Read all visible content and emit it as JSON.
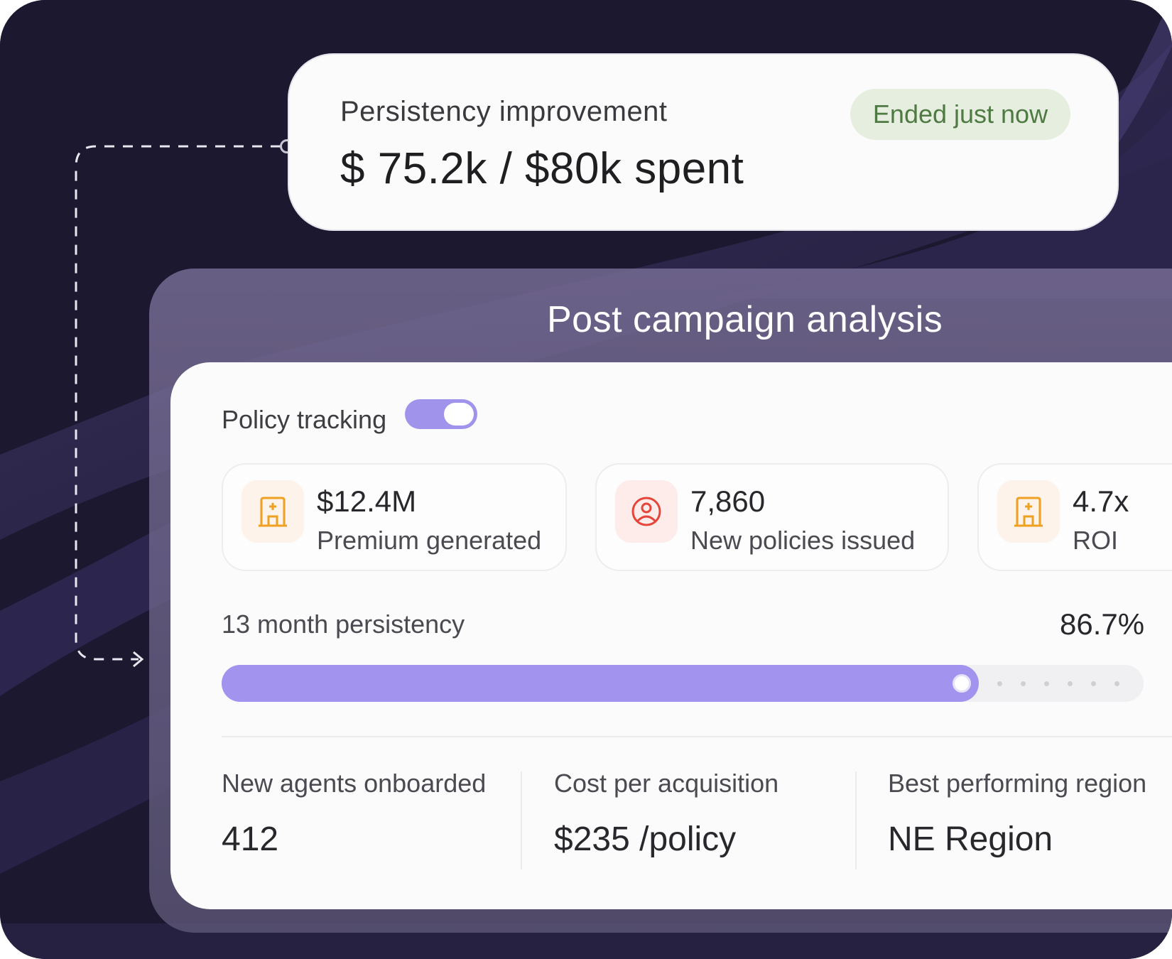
{
  "campaign": {
    "title": "Persistency improvement",
    "spend": "$ 75.2k / $80k spent",
    "status_badge": "Ended just now"
  },
  "analysis": {
    "title": "Post campaign analysis",
    "policy_tracking_label": "Policy tracking",
    "policy_tracking_enabled": true,
    "stats": [
      {
        "icon": "hospital-icon",
        "value": "$12.4M",
        "label": "Premium generated",
        "icon_color": "#f0a020"
      },
      {
        "icon": "user-circle-icon",
        "value": "7,860",
        "label": "New policies issued",
        "icon_color": "#e5453a"
      },
      {
        "icon": "hospital-icon",
        "value": "4.7x",
        "label": "ROI",
        "icon_color": "#f0a020"
      }
    ],
    "persistency": {
      "label": "13 month persistency",
      "value_text": "86.7%",
      "value": 0.867
    },
    "metrics": [
      {
        "label": "New agents onboarded",
        "value": "412"
      },
      {
        "label": "Cost per acquisition",
        "value": "$235 /policy"
      },
      {
        "label": "Best performing region",
        "value": "NE Region"
      }
    ]
  },
  "colors": {
    "accent": "#a193ee",
    "badge_text": "#4f7a43",
    "badge_bg": "#e6eedf"
  }
}
